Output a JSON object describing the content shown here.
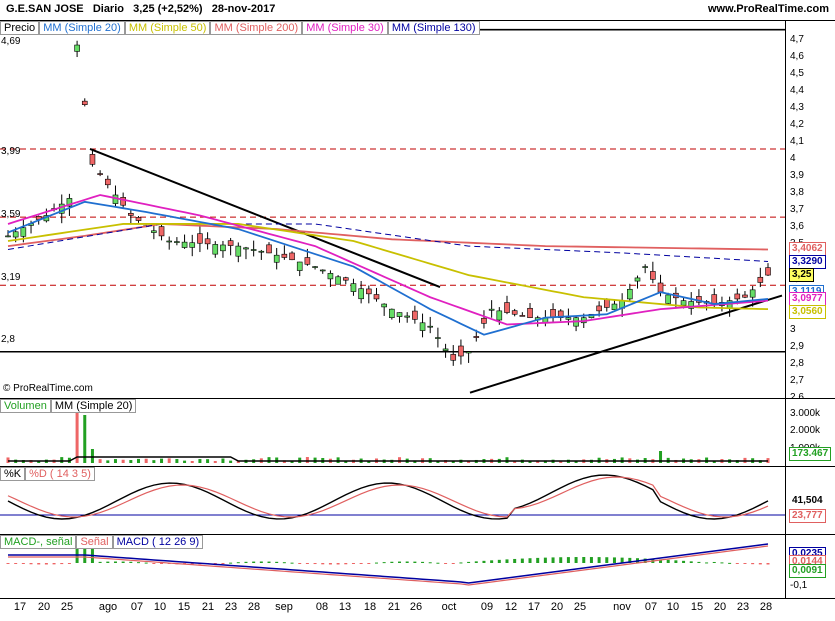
{
  "header": {
    "instrument": "G.E.SAN JOSE",
    "period": "Diario",
    "change": "3,25 (+2,52%)",
    "date": "28-nov-2017",
    "site": "www.ProRealTime.com"
  },
  "price_pane": {
    "legend": [
      {
        "label": "Precio",
        "color": "#000000"
      },
      {
        "label": "MM (Simple 20)",
        "color": "#1f6fd0"
      },
      {
        "label": "MM (Simple 50)",
        "color": "#c8c000"
      },
      {
        "label": "MM (Simple 200)",
        "color": "#e06060"
      },
      {
        "label": "MM (Simple 30)",
        "color": "#e020c0"
      },
      {
        "label": "MM (Simple 130)",
        "color": "#0000a0"
      }
    ],
    "level_labels": [
      "4,69",
      "3,99",
      "3,59",
      "3,19",
      "2,8"
    ],
    "copyright": "© ProRealTime.com",
    "axis_ticks": [
      "4,7",
      "4,6",
      "4,5",
      "4,4",
      "4,3",
      "4,2",
      "4,1",
      "4",
      "3,9",
      "3,8",
      "3,7",
      "3,6",
      "3,5",
      "3,4",
      "3,3",
      "3,2",
      "3,1",
      "3",
      "2,9",
      "2,8",
      "2,7",
      "2,6",
      "2,5"
    ],
    "tags": [
      {
        "text": "3,4062",
        "color": "#e06060"
      },
      {
        "text": "3,3290",
        "color": "#0000a0"
      },
      {
        "text": "3,25",
        "color": "#000000"
      },
      {
        "text": "3,1119",
        "color": "#1f6fd0"
      },
      {
        "text": "3,0977",
        "color": "#e020c0"
      },
      {
        "text": "3,0560",
        "color": "#c8c000"
      }
    ]
  },
  "volume_pane": {
    "legend": [
      {
        "label": "Volumen",
        "color": "#22a022"
      },
      {
        "label": "MM (Simple 20)",
        "color": "#000000"
      }
    ],
    "axis_ticks": [
      "3.000k",
      "2.000k",
      "1.000k"
    ],
    "tag": "173.467"
  },
  "stoch_pane": {
    "legend": [
      {
        "label": "%K",
        "color": "#000000"
      },
      {
        "label": "%D ( 14 3 5)",
        "color": "#e06060"
      }
    ],
    "tags": [
      "41,504",
      "23,777"
    ]
  },
  "macd_pane": {
    "legend": [
      {
        "label": "MACD-, señal",
        "color": "#22a022"
      },
      {
        "label": "Señal",
        "color": "#e06060"
      },
      {
        "label": "MACD ( 12 26 9)",
        "color": "#0000a0"
      }
    ],
    "axis_ticks": [
      "0,0235",
      "0,0144",
      "0,0091",
      "-0,1"
    ]
  },
  "x_axis": [
    "17",
    "20",
    "25",
    "ago",
    "07",
    "10",
    "15",
    "21",
    "23",
    "28",
    "sep",
    "08",
    "13",
    "18",
    "21",
    "26",
    "oct",
    "09",
    "12",
    "17",
    "20",
    "25",
    "nov",
    "07",
    "10",
    "15",
    "20",
    "23",
    "28"
  ]
}
